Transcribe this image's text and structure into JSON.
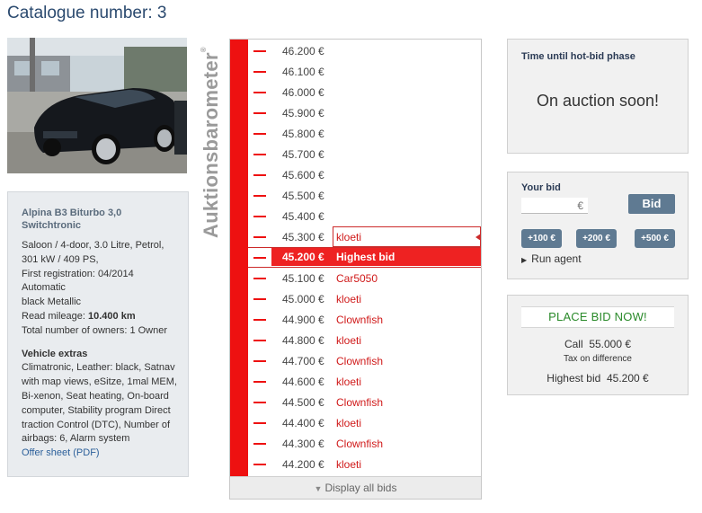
{
  "page": {
    "title": "Catalogue number: 3"
  },
  "vehicle": {
    "name": "Alpina B3 Biturbo 3,0 Switchtronic",
    "details": [
      "Saloon / 4-door, 3.0 Litre, Petrol,",
      "301 kW / 409 PS,",
      "First registration: 04/2014",
      "Automatic",
      "black Metallic"
    ],
    "mileage_label": "Read mileage:",
    "mileage_value": "10.400  km",
    "owners": "Total number of owners: 1 Owner",
    "extras_title": "Vehicle extras",
    "extras_text": [
      "Climatronic, Leather: black, Satnav",
      "with map views, eSitze, 1mal MEM,",
      "Bi-xenon, Seat heating, On-board",
      "computer, Stability program Direct",
      "traction Control (DTC), Number of",
      "airbags: 6, Alarm system"
    ],
    "offer_link": "Offer sheet (PDF)"
  },
  "barometer": {
    "label": "Auktionsbarometer",
    "trademark": "®",
    "bids": [
      {
        "amount": "46.200 €",
        "bidder": ""
      },
      {
        "amount": "46.100 €",
        "bidder": ""
      },
      {
        "amount": "46.000 €",
        "bidder": ""
      },
      {
        "amount": "45.900 €",
        "bidder": ""
      },
      {
        "amount": "45.800 €",
        "bidder": ""
      },
      {
        "amount": "45.700 €",
        "bidder": ""
      },
      {
        "amount": "45.600 €",
        "bidder": ""
      },
      {
        "amount": "45.500 €",
        "bidder": ""
      },
      {
        "amount": "45.400 €",
        "bidder": ""
      },
      {
        "amount": "45.300 €",
        "bidder": "kloeti"
      },
      {
        "amount": "45.200 €",
        "bidder": "Highest bid"
      },
      {
        "amount": "45.100 €",
        "bidder": "Car5050"
      },
      {
        "amount": "45.000 €",
        "bidder": "kloeti"
      },
      {
        "amount": "44.900 €",
        "bidder": "Clownfish"
      },
      {
        "amount": "44.800 €",
        "bidder": "kloeti"
      },
      {
        "amount": "44.700 €",
        "bidder": "Clownfish"
      },
      {
        "amount": "44.600 €",
        "bidder": "kloeti"
      },
      {
        "amount": "44.500 €",
        "bidder": "Clownfish"
      },
      {
        "amount": "44.400 €",
        "bidder": "kloeti"
      },
      {
        "amount": "44.300 €",
        "bidder": "Clownfish"
      },
      {
        "amount": "44.200 €",
        "bidder": "kloeti"
      }
    ],
    "show_all": "Display all bids",
    "colors": {
      "accent": "#ee1111"
    }
  },
  "time_panel": {
    "title": "Time until hot-bid phase",
    "status": "On auction soon!"
  },
  "bid_panel": {
    "title": "Your bid",
    "currency": "€",
    "bid_button": "Bid",
    "increments": [
      "+100 €",
      "+200 €",
      "+500 €"
    ],
    "run_agent": "Run agent"
  },
  "place_panel": {
    "title": "PLACE BID NOW!",
    "call_label": "Call",
    "call_value": "55.000 €",
    "tax_note": "Tax on difference",
    "highest_label": "Highest bid",
    "highest_value": "45.200 €"
  }
}
